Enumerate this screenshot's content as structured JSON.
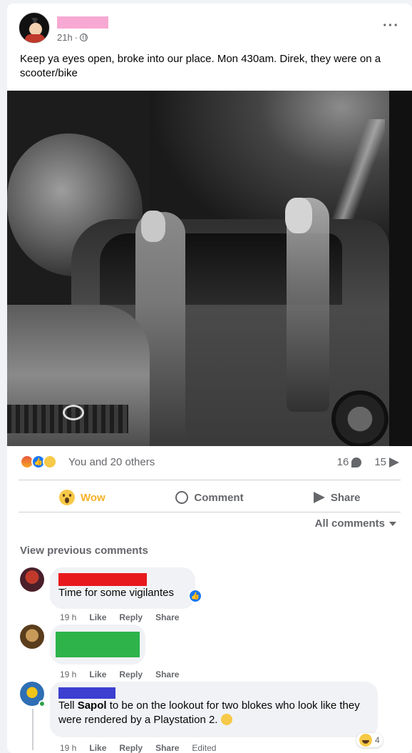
{
  "post": {
    "time": "21h",
    "text": "Keep ya eyes open, broke into our place. Mon 430am. Direk, they were on a scooter/bike",
    "more_icon": "more-icon",
    "privacy_icon": "globe-icon",
    "name_redaction_color": "#f7a9d3"
  },
  "reactions": {
    "summary": "You and 20 others",
    "comments_count": "16",
    "shares_count": "15",
    "types": [
      "angry",
      "like",
      "wow"
    ]
  },
  "actions": {
    "wow_label": "Wow",
    "comment_label": "Comment",
    "share_label": "Share"
  },
  "comments_filter": "All comments",
  "view_previous": "View previous comments",
  "comments": [
    {
      "text": "Time for some vigilantes",
      "time": "19 h",
      "like": "Like",
      "reply": "Reply",
      "share": "Share",
      "name_redaction_color": "#e8191d"
    },
    {
      "text": "",
      "time": "19 h",
      "like": "Like",
      "reply": "Reply",
      "share": "Share",
      "redaction_color": "#2db34a"
    },
    {
      "text_before": "Tell ",
      "text_bold": "Sapol",
      "text_after": " to be on the lookout for two blokes who look like they were rendered by a Playstation 2.",
      "time": "19 h",
      "like": "Like",
      "reply": "Reply",
      "share": "Share",
      "edited": "Edited",
      "reaction_count": "4",
      "name_redaction_color": "#3c3fcf"
    }
  ],
  "colors": {
    "accent": "#1877f2",
    "wow": "#f7b125",
    "muted": "#65676b"
  }
}
